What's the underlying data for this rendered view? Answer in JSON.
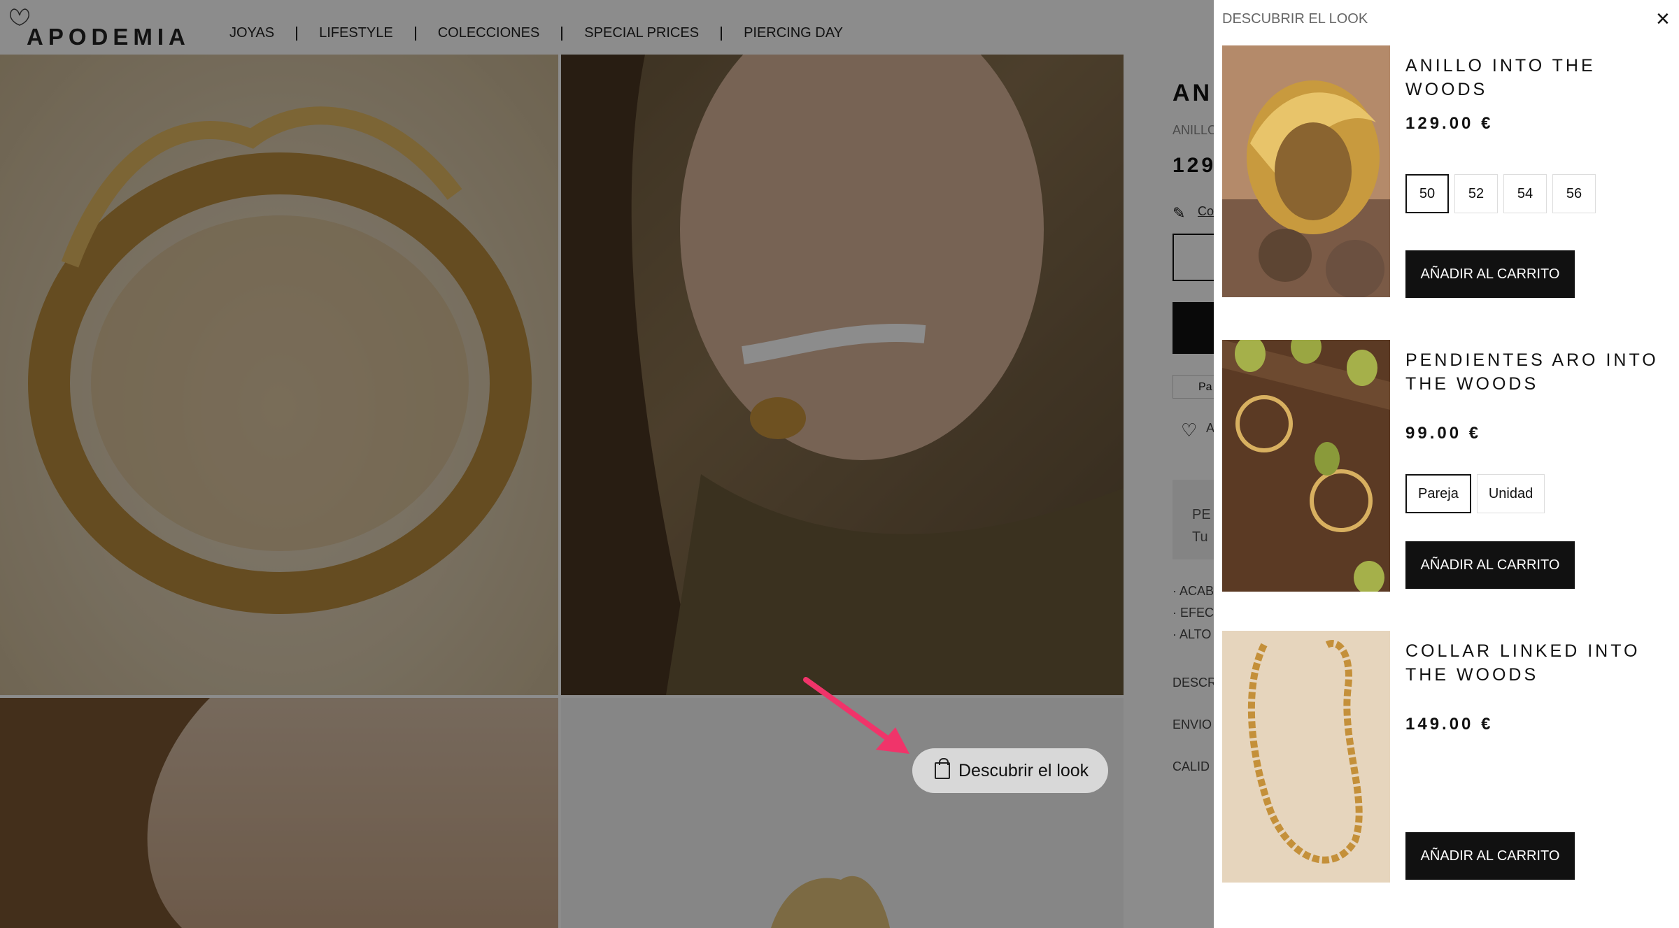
{
  "header": {
    "logo": "APODEMIA",
    "nav": [
      "JOYAS",
      "LIFESTYLE",
      "COLECCIONES",
      "SPECIAL PRICES",
      "PIERCING DAY"
    ]
  },
  "product_partial": {
    "title": "AN",
    "subtitle": "ANILLO",
    "price": "129",
    "guide": "Co",
    "small_button": "Pa",
    "wishlist": "A",
    "box_line1": "PE",
    "box_line2": "Tu",
    "bullets": [
      "· ACAB",
      "· EFEC",
      "· ALTO"
    ],
    "accordions": [
      "DESCR",
      "ENVIO",
      "CALID"
    ]
  },
  "look_button": {
    "label": "Descubrir el look"
  },
  "drawer": {
    "title": "DESCUBRIR EL LOOK",
    "close": "×",
    "items": [
      {
        "name": "ANILLO INTO THE WOODS",
        "price": "129.00 €",
        "options": [
          "50",
          "52",
          "54",
          "56"
        ],
        "selected_option": "50",
        "add_label": "AÑADIR AL CARRITO"
      },
      {
        "name": "PENDIENTES ARO INTO THE WOODS",
        "price": "99.00 €",
        "options": [
          "Pareja",
          "Unidad"
        ],
        "selected_option": "Pareja",
        "add_label": "AÑADIR AL CARRITO"
      },
      {
        "name": "COLLAR LINKED INTO THE WOODS",
        "price": "149.00 €",
        "options": [],
        "selected_option": "",
        "add_label": "AÑADIR AL CARRITO"
      }
    ]
  },
  "colors": {
    "overlay": "#000000",
    "button_bg": "#111111",
    "arrow": "#f0346a"
  }
}
